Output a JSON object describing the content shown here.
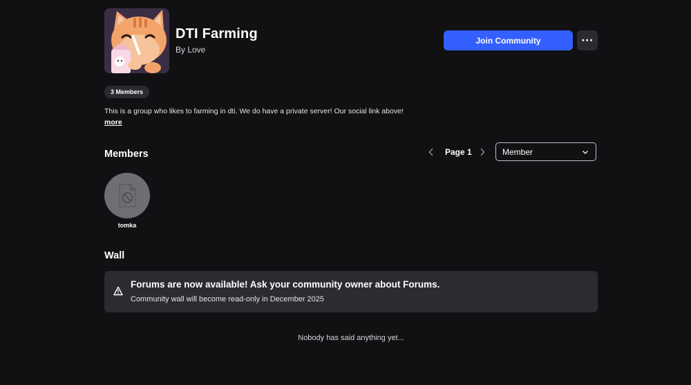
{
  "group": {
    "name": "DTI Farming",
    "owner_text": "By Love",
    "member_count_badge": "3 Members",
    "description": "This is a group who likes to farming in dti. We do have a private server! Our social link above!",
    "more_link": "more"
  },
  "actions": {
    "join_label": "Join Community",
    "more_options_label": "···"
  },
  "members_section": {
    "title": "Members",
    "page_label": "Page 1",
    "prev_icon": "chevron-left-icon",
    "next_icon": "chevron-right-icon",
    "role_select_value": "Member",
    "members": [
      {
        "name": "tomka",
        "avatar_icon": "broken-image-icon"
      }
    ]
  },
  "wall": {
    "title": "Wall",
    "alert_icon": "warning-icon",
    "alert_title": "Forums are now available! Ask your community owner about Forums.",
    "alert_subtitle": "Community wall will become read-only in December 2025",
    "empty_message": "Nobody has said anything yet..."
  },
  "colors": {
    "background": "#111114",
    "accent": "#335fff",
    "surface": "#2b2c31"
  }
}
